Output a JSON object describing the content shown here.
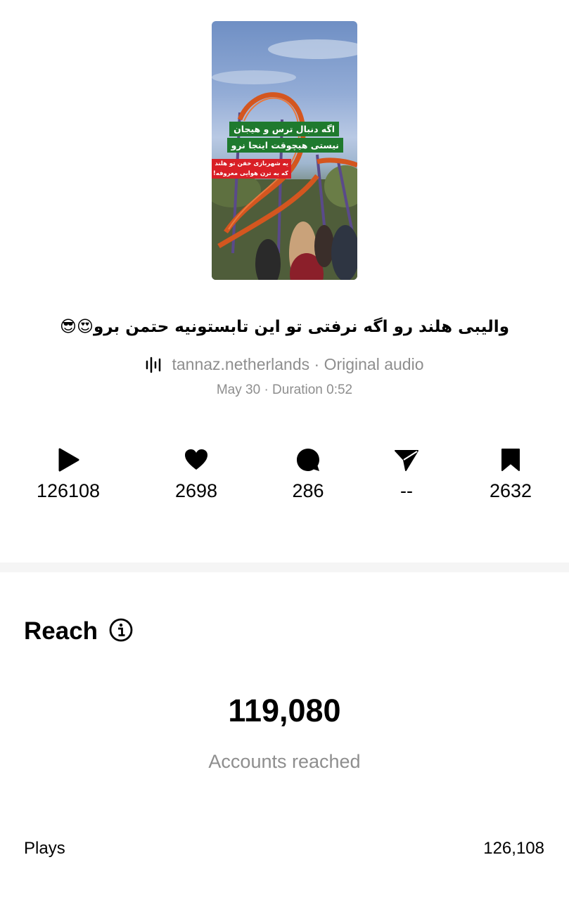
{
  "post": {
    "thumbnail": {
      "caption_line1": "اگه دنبال ترس و هیجان",
      "caption_line2": "نیستی هیچوقت اینجا نرو",
      "subcaption_line1": "یه شهربازی خفن تو هلند",
      "subcaption_line2": "که به ترن هوایی معروفه!"
    },
    "caption": "والیبی هلند رو اگه نرفتی تو این تابستونیه حتمن برو😍😎",
    "audio": "tannaz.netherlands · Original audio",
    "date_duration": "May 30 · Duration 0:52"
  },
  "stats": [
    {
      "icon": "play-icon",
      "value": "126108"
    },
    {
      "icon": "heart-icon",
      "value": "2698"
    },
    {
      "icon": "comment-icon",
      "value": "286"
    },
    {
      "icon": "share-icon",
      "value": "--"
    },
    {
      "icon": "bookmark-icon",
      "value": "2632"
    }
  ],
  "reach": {
    "title": "Reach",
    "accounts_reached_value": "119,080",
    "accounts_reached_label": "Accounts reached",
    "plays_label": "Plays",
    "plays_value": "126,108"
  },
  "colors": {
    "secondary_text": "#8e8e8e",
    "coaster_track": "#d4561f",
    "caption_green": "#1f7a2e",
    "caption_red": "#d91f26"
  }
}
